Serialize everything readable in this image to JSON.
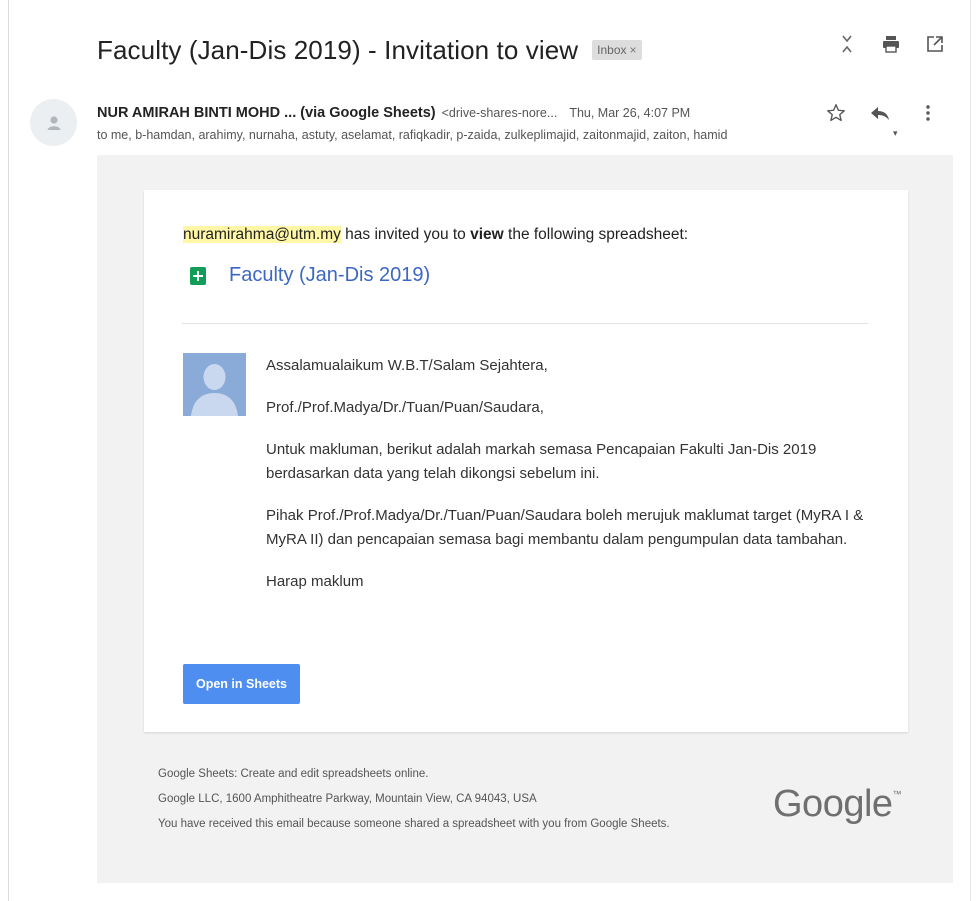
{
  "email": {
    "subject": "Faculty (Jan-Dis 2019) - Invitation to view",
    "label": "Inbox",
    "label_close": "×",
    "sender_name": "NUR AMIRAH BINTI MOHD ... (via Google Sheets)",
    "sender_email": "<drive-shares-nore...",
    "date": "Thu, Mar 26, 4:07 PM",
    "recipients": "to me, b-hamdan, arahimy, nurnaha, astuty, aselamat, rafiqkadir, p-zaida, zulkeplimajid, zaitonmajid, zaiton, hamid",
    "recipients_caret": "▾"
  },
  "icons": {
    "top": [
      "expand-collapse-icon",
      "print-icon",
      "open-in-new-window-icon"
    ],
    "sender": [
      "star-icon",
      "reply-icon",
      "more-options-icon"
    ]
  },
  "card": {
    "inviter_email": "nuramirahma@utm.my",
    "invite_mid": " has invited you to ",
    "invite_bold": "view",
    "invite_tail": " the following spreadsheet:",
    "sheet_title": "Faculty (Jan-Dis 2019)",
    "message": {
      "greeting": "Assalamualaikum W.B.T/Salam Sejahtera,",
      "salutation": "Prof./Prof.Madya/Dr./Tuan/Puan/Saudara,",
      "para1": "Untuk makluman, berikut adalah markah semasa Pencapaian Fakulti Jan-Dis 2019 berdasarkan data yang telah dikongsi sebelum ini.",
      "para2": "Pihak Prof./Prof.Madya/Dr./Tuan/Puan/Saudara boleh merujuk maklumat target (MyRA I & MyRA II) dan pencapaian semasa bagi membantu dalam pengumpulan data tambahan.",
      "closing": "Harap maklum"
    },
    "button_label": "Open in Sheets"
  },
  "footer": {
    "line1": "Google Sheets: Create and edit spreadsheets online.",
    "line2": "Google LLC, 1600 Amphitheatre Parkway, Mountain View, CA 94043, USA",
    "line3": "You have received this email because someone shared a spreadsheet with you from Google Sheets.",
    "logo_text": "Google",
    "logo_tm": "™"
  },
  "colors": {
    "link": "#3c67c3",
    "button": "#4d8ef0",
    "sheets_green": "#0f9d58",
    "highlight": "#fff7a6",
    "mail_background": "#f2f2f2"
  }
}
